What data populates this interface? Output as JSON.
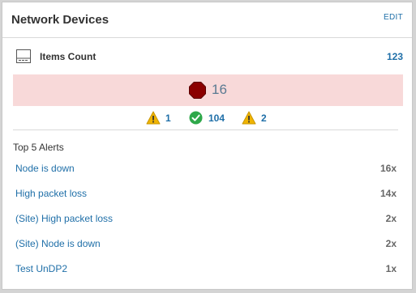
{
  "widget": {
    "title": "Network Devices",
    "edit_label": "EDIT"
  },
  "items": {
    "label": "Items Count",
    "count": "123",
    "icon": "network-device-icon"
  },
  "critical": {
    "icon": "critical-stop-icon",
    "color": "#8b0000",
    "band_color": "#f8d9d9",
    "count": "16"
  },
  "status": [
    {
      "icon": "warning-icon",
      "color": "#f0b400",
      "count": "1"
    },
    {
      "icon": "ok-check-icon",
      "color": "#2ea84a",
      "count": "104"
    },
    {
      "icon": "warning-icon",
      "color": "#f0b400",
      "count": "2"
    }
  ],
  "alerts": {
    "title": "Top 5 Alerts",
    "rows": [
      {
        "name": "Node is down",
        "count": "16x"
      },
      {
        "name": "High packet loss",
        "count": "14x"
      },
      {
        "name": "(Site) High packet loss",
        "count": "2x"
      },
      {
        "name": "(Site) Node is down",
        "count": "2x"
      },
      {
        "name": "Test UnDP2",
        "count": "1x"
      }
    ]
  },
  "colors": {
    "link": "#1f6fa8",
    "text": "#333333"
  }
}
